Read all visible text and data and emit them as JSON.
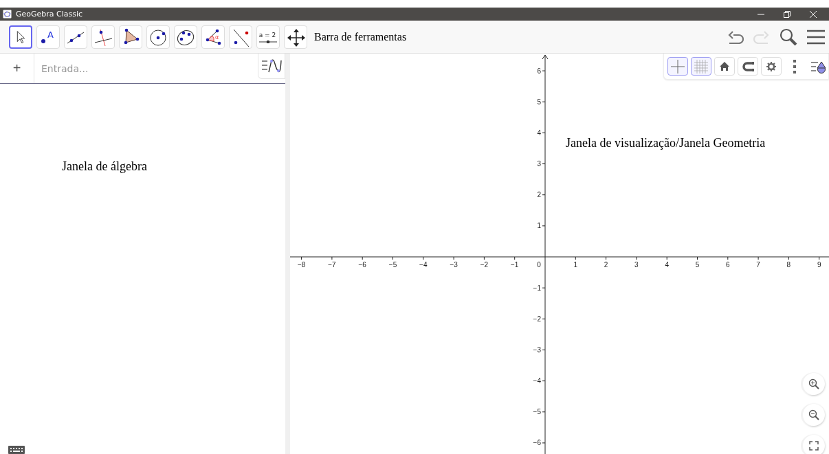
{
  "window": {
    "title": "GeoGebra Classic"
  },
  "toolbar": {
    "tools": [
      {
        "kind": "move",
        "selected": true
      },
      {
        "kind": "point",
        "label": "A",
        "selected": false
      },
      {
        "kind": "line",
        "selected": false
      },
      {
        "kind": "perpendicular",
        "selected": false
      },
      {
        "kind": "polygon",
        "selected": false
      },
      {
        "kind": "circle",
        "selected": false
      },
      {
        "kind": "conic",
        "selected": false
      },
      {
        "kind": "angle",
        "label": "α",
        "selected": false
      },
      {
        "kind": "reflect",
        "selected": false
      },
      {
        "kind": "slider",
        "label": "a = 2",
        "selected": false
      },
      {
        "kind": "pan",
        "selected": false
      }
    ],
    "caption": "Barra de ferramentas"
  },
  "algebra": {
    "add": "+",
    "input": {
      "placeholder": "Entrada..."
    },
    "caption": "Janela de álgebra"
  },
  "graphics": {
    "caption": "Janela de visualização/Janela Geometria",
    "style_bar": [
      {
        "kind": "axes",
        "selected": true
      },
      {
        "kind": "grid",
        "selected": true
      },
      {
        "kind": "home",
        "selected": false
      },
      {
        "kind": "magnet",
        "selected": false
      },
      {
        "kind": "gear",
        "selected": false
      },
      {
        "kind": "more"
      },
      {
        "kind": "toggle"
      }
    ],
    "x_labels": [
      "−8",
      "−7",
      "−6",
      "−5",
      "−4",
      "−3",
      "−2",
      "−1",
      "0",
      "1",
      "2",
      "3",
      "4",
      "5",
      "6",
      "7",
      "8",
      "9"
    ],
    "y_labels": [
      "6",
      "5",
      "4",
      "3",
      "2",
      "1",
      "−1",
      "−2",
      "−3",
      "−4",
      "−5",
      "−6"
    ]
  }
}
